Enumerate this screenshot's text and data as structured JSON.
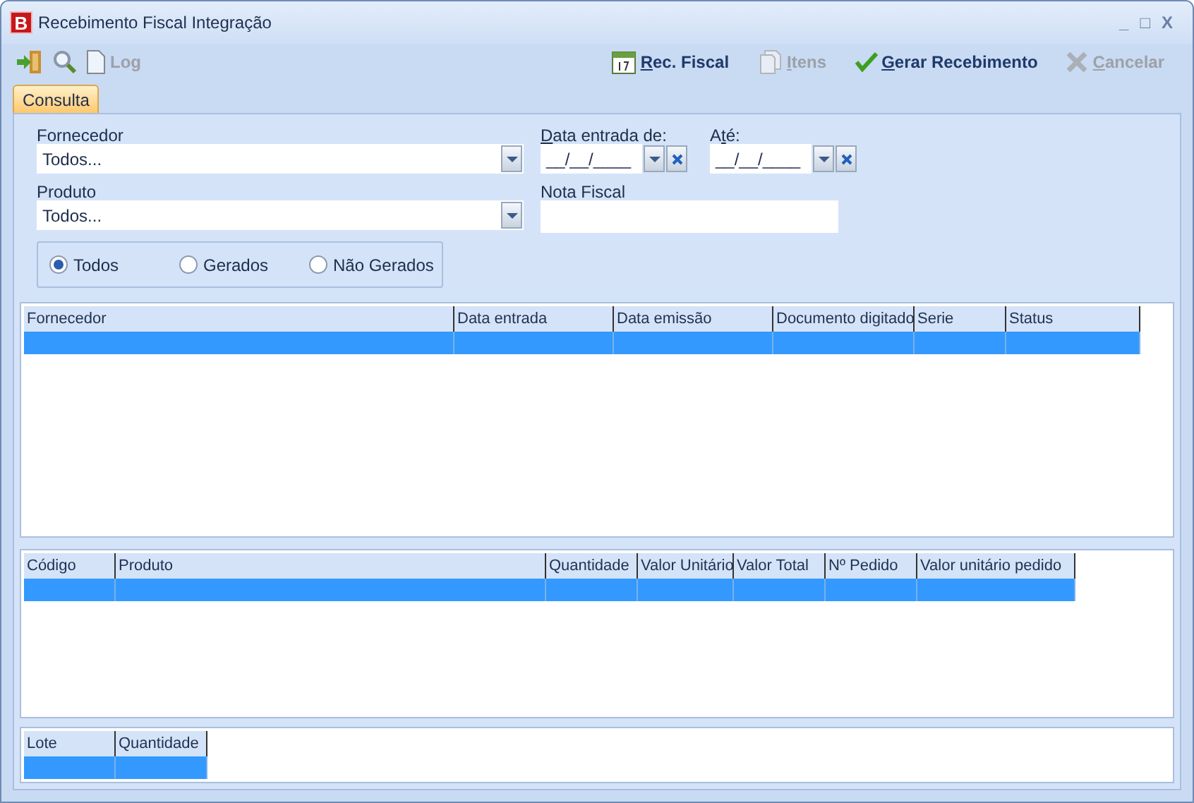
{
  "window": {
    "logo": "B",
    "title": "Recebimento Fiscal Integração",
    "controls": [
      "_",
      "□",
      "X"
    ]
  },
  "toolbar_left": [
    {
      "kind": "exit",
      "disabled": false
    },
    {
      "kind": "search",
      "disabled": false
    },
    {
      "kind": "log",
      "label": {
        "pre": "Log"
      },
      "disabled": true
    }
  ],
  "toolbar_right": [
    {
      "kind": "calendar",
      "label": {
        "key": "R",
        "post": "ec. Fiscal"
      },
      "disabled": false
    },
    {
      "kind": "pages",
      "label": {
        "key": "I",
        "post": "tens"
      },
      "disabled": true
    },
    {
      "kind": "check",
      "label": {
        "key": "G",
        "post": "erar Recebimento"
      },
      "disabled": false
    },
    {
      "kind": "cancel",
      "label": {
        "key": "C",
        "post": "ancelar"
      },
      "disabled": true
    }
  ],
  "tabs": [
    {
      "label": "Consulta",
      "selected": true
    }
  ],
  "filters": {
    "fornecedor": {
      "label": "Fornecedor",
      "value": "Todos..."
    },
    "produto": {
      "label": "Produto",
      "value": "Todos..."
    },
    "data_de": {
      "label": {
        "key": "D",
        "post": "ata entrada de:"
      },
      "value": "__/__/____"
    },
    "data_ate": {
      "label": {
        "pre": "A",
        "key": "t",
        "post": "é:"
      },
      "value": "__/__/____"
    },
    "nota_fiscal": {
      "label": "Nota Fiscal"
    }
  },
  "status_options": [
    {
      "label": "Todos",
      "selected": true
    },
    {
      "label": "Gerados",
      "selected": false
    },
    {
      "label": "Não Gerados",
      "selected": false
    }
  ],
  "grids": [
    {
      "columns": [
        "Fornecedor",
        "Data entrada",
        "Data emissão",
        "Documento digitado",
        "Serie",
        "Status"
      ],
      "rows": [
        {
          "selected": true
        }
      ]
    },
    {
      "columns": [
        "Código",
        "Produto",
        "Quantidade",
        "Valor Unitário",
        "Valor Total",
        "Nº Pedido",
        "Valor unitário pedido"
      ],
      "rows": [
        {
          "selected": true
        }
      ]
    },
    {
      "columns": [
        "Lote",
        "Quantidade"
      ],
      "rows": [
        {
          "selected": true
        }
      ]
    }
  ]
}
